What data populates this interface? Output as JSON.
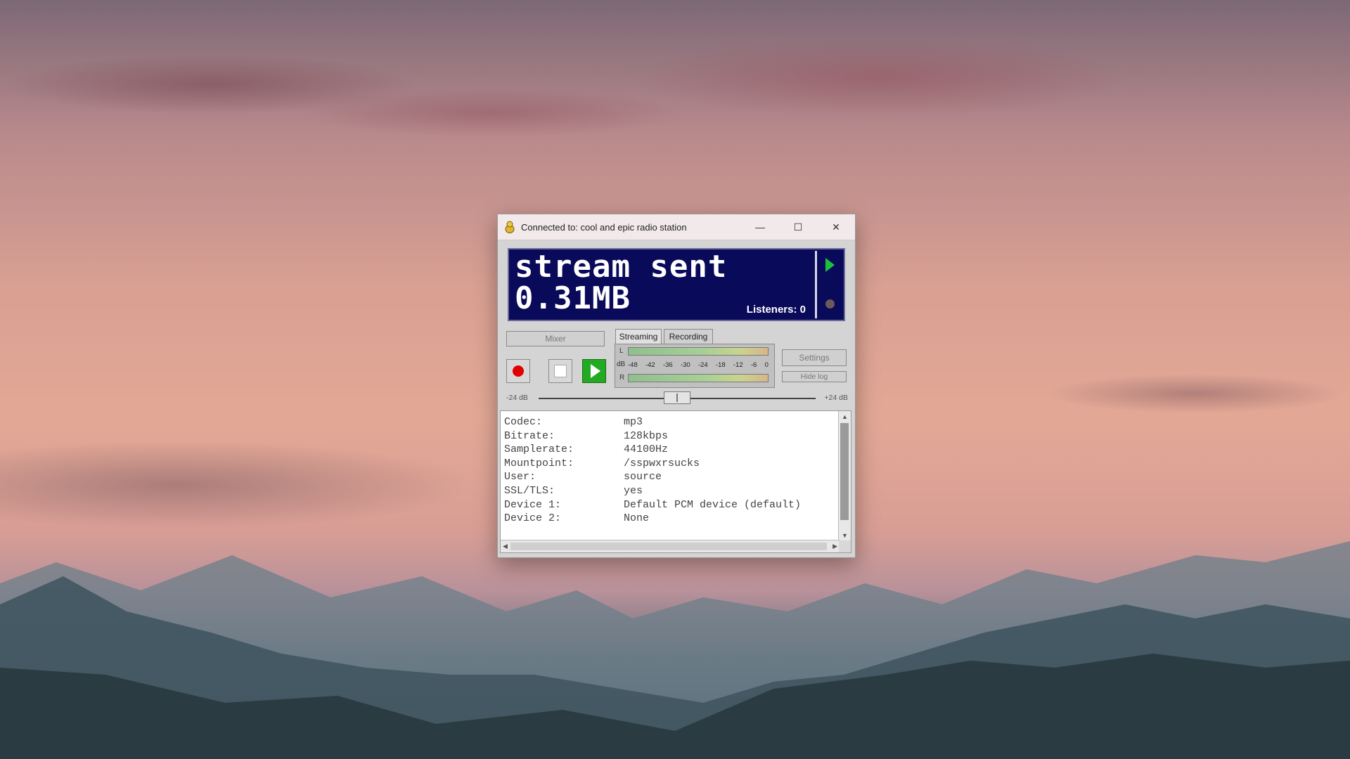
{
  "window": {
    "title": "Connected to: cool and epic radio station",
    "minimize": "—",
    "maximize": "☐",
    "close": "✕"
  },
  "display": {
    "line1": "stream sent",
    "line2": "0.31MB",
    "listeners_label": "Listeners:",
    "listeners_value": "0"
  },
  "controls": {
    "mixer": "Mixer",
    "tabs": [
      "Streaming",
      "Recording"
    ],
    "settings": "Settings",
    "hide_log": "Hide log"
  },
  "meter": {
    "left_label": "L",
    "db_label": "dB",
    "right_label": "R",
    "scale": [
      "-48",
      "-42",
      "-36",
      "-30",
      "-24",
      "-18",
      "-12",
      "-6",
      "0"
    ]
  },
  "gain": {
    "min_label": "-24 dB",
    "max_label": "+24 dB",
    "value_fraction": 0.5
  },
  "log": {
    "rows": [
      {
        "key": "Codec:",
        "value": "mp3"
      },
      {
        "key": "Bitrate:",
        "value": "128kbps"
      },
      {
        "key": "Samplerate:",
        "value": "44100Hz"
      },
      {
        "key": "Mountpoint:",
        "value": "/sspwxrsucks"
      },
      {
        "key": "User:",
        "value": "source"
      },
      {
        "key": "SSL/TLS:",
        "value": "yes"
      },
      {
        "key": "Device 1:",
        "value": "Default PCM device (default)"
      },
      {
        "key": "Device 2:",
        "value": "None"
      }
    ]
  }
}
